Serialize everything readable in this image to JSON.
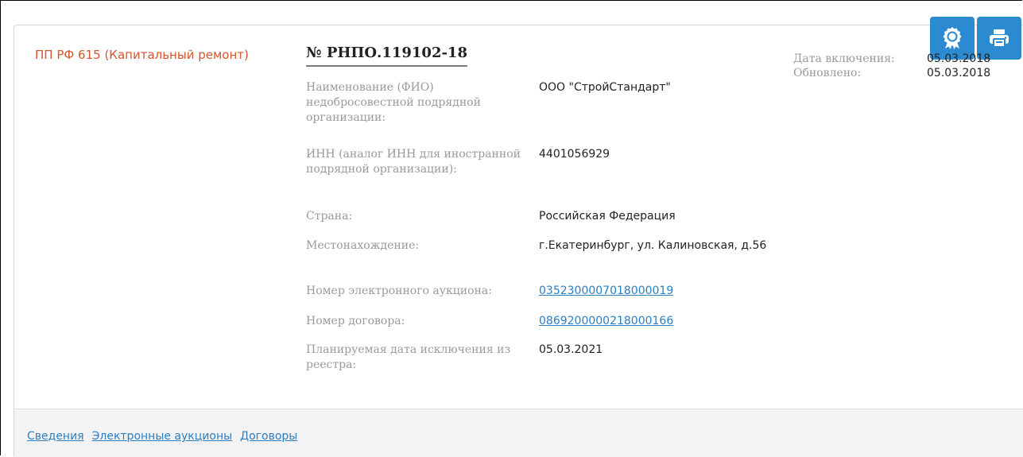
{
  "card": {
    "type_label": "ПП РФ 615 (Капитальный ремонт)",
    "reg_number": "№ РНПО.119102-18"
  },
  "actions": {
    "certificate_icon": "award-ribbon-icon",
    "print_icon": "printer-icon",
    "accent_color": "#2c8bd0"
  },
  "meta": {
    "included_label": "Дата включения:",
    "included_value": "05.03.2018",
    "updated_label": "Обновлено:",
    "updated_value": "05.03.2018"
  },
  "fields": {
    "name": {
      "label": "Наименование (ФИО) недобросовестной подрядной организации:",
      "value": "ООО \"СтройСтандарт\""
    },
    "inn": {
      "label": "ИНН (аналог ИНН для иностранной подрядной организации):",
      "value": "4401056929"
    },
    "country": {
      "label": "Страна:",
      "value": "Российская Федерация"
    },
    "location": {
      "label": "Местонахождение:",
      "value": "г.Екатеринбург, ул. Калиновская, д.56"
    },
    "auction": {
      "label": "Номер электронного аукциона:",
      "value": "0352300007018000019"
    },
    "contract": {
      "label": "Номер договора:",
      "value": "0869200000218000166"
    },
    "exclusion": {
      "label": "Планируемая дата исключения из реестра:",
      "value": "05.03.2021"
    }
  },
  "footer": {
    "tabs": [
      "Сведения",
      "Электронные аукционы",
      "Договоры"
    ]
  }
}
